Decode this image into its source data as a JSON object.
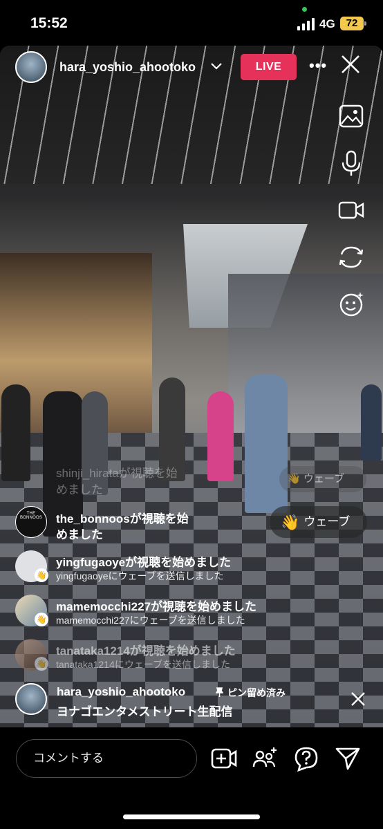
{
  "status": {
    "time": "15:52",
    "network": "4G",
    "battery": "72"
  },
  "header": {
    "username": "hara_yoshio_ahootoko",
    "live_label": "LIVE"
  },
  "wave": {
    "label": "ウェーブ",
    "ghost_label": "ウェーブ"
  },
  "comments": [
    {
      "name": "shinji_hirataが視聴を始",
      "sub": "めました"
    },
    {
      "name": "the_bonnoosが視聴を始",
      "sub": "めました"
    },
    {
      "name": "yingfugaoyeが視聴を始めました",
      "sub": "yingfugaoyeにウェーブを送信しました"
    },
    {
      "name": "mamemocchi227が視聴を始めました",
      "sub": "mamemocchi227にウェーブを送信しました"
    },
    {
      "name": "tanataka1214が視聴を始めました",
      "sub": "tanataka1214にウェーブを送信しました"
    }
  ],
  "avatar_texts": {
    "bonnoos": "THE BONNOOS"
  },
  "pinned": {
    "username": "hara_yoshio_ahootoko",
    "label": "ピン留め済み",
    "text": "ヨナゴエンタメストリート生配信"
  },
  "bottom": {
    "comment_placeholder": "コメントする"
  },
  "colors": {
    "live": "#e6315b",
    "battery": "#f2c94c",
    "status_dot": "#34c759"
  }
}
